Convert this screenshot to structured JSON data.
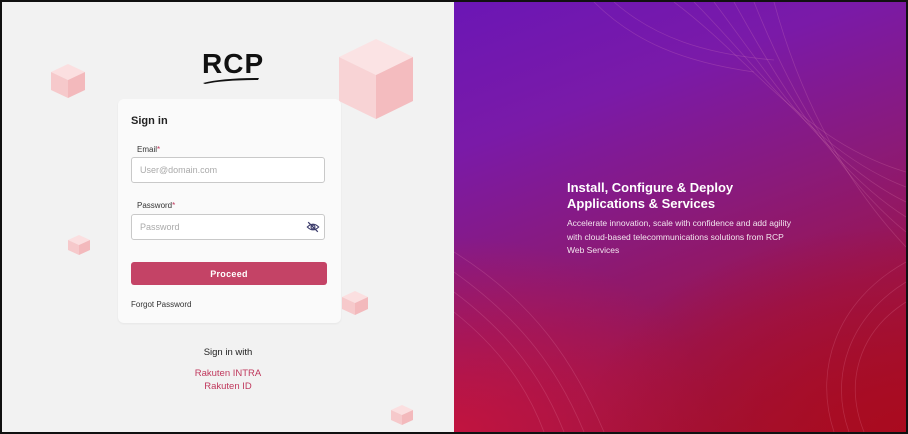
{
  "brand": {
    "logo_text": "RCP"
  },
  "signin": {
    "title": "Sign in",
    "email_label": "Email",
    "email_placeholder": "User@domain.com",
    "password_label": "Password",
    "password_placeholder": "Password",
    "required_mark": "*",
    "proceed_label": "Proceed",
    "forgot_label": "Forgot Password"
  },
  "sso": {
    "heading": "Sign in with",
    "providers": [
      "Rakuten INTRA",
      "Rakuten ID"
    ]
  },
  "hero": {
    "title": "Install, Configure & Deploy Applications & Services",
    "subtitle": "Accelerate innovation, scale with confidence and add agility with cloud-based telecommunications solutions from RCP Web Services"
  },
  "colors": {
    "accent": "#c44366",
    "link": "#c0395d",
    "cube": "#f6c7c9"
  },
  "icons": {
    "password_toggle": "eye-off-icon"
  }
}
